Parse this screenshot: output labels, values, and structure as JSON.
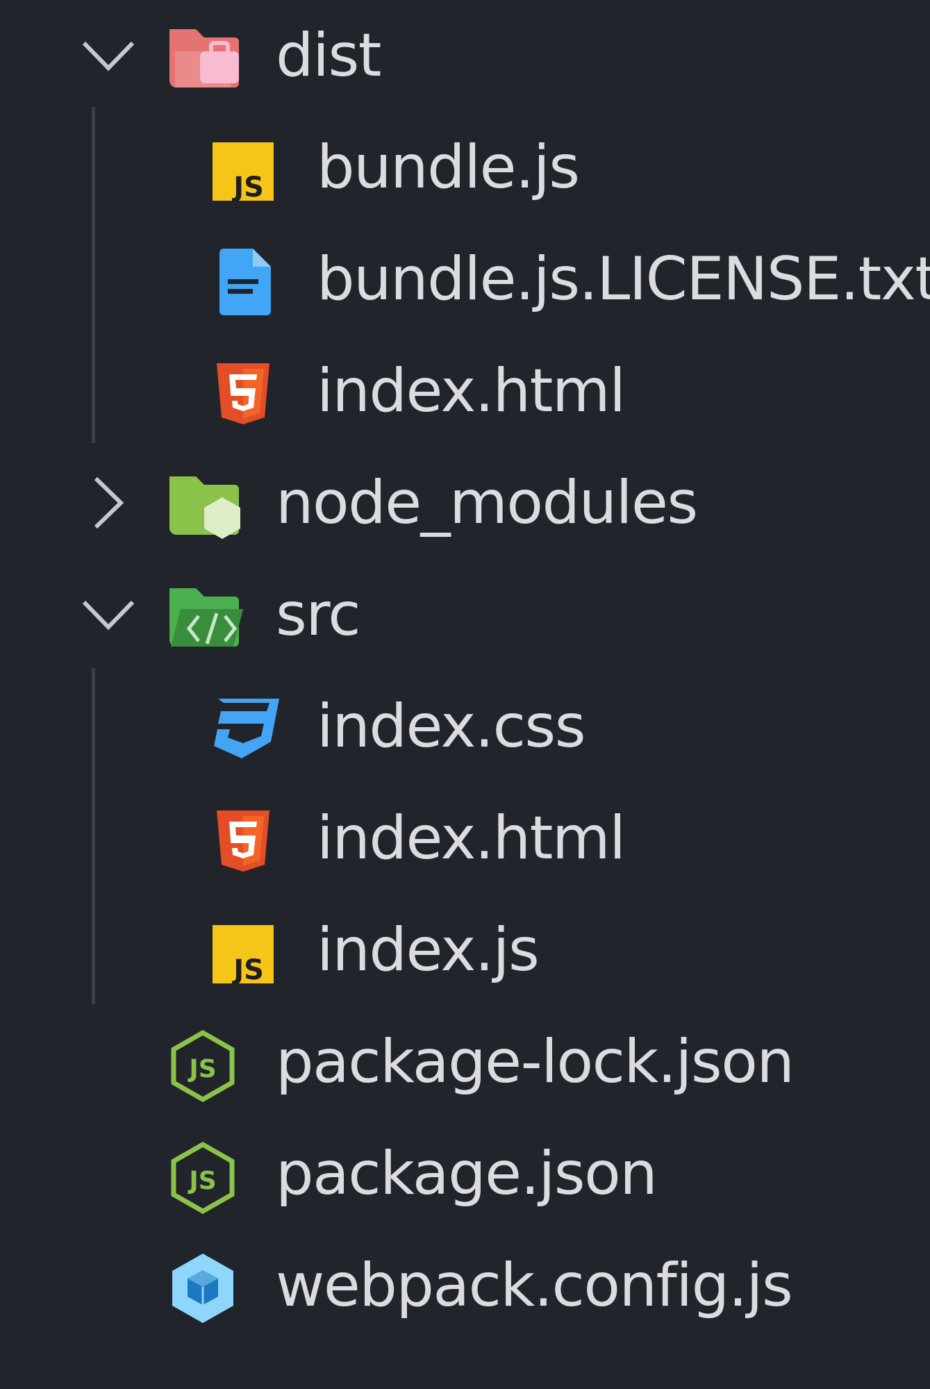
{
  "explorer": {
    "items": [
      {
        "label": "dist",
        "kind": "folder",
        "depth": 0,
        "expanded": true,
        "icon": "folder-dist-open-icon"
      },
      {
        "label": "bundle.js",
        "kind": "file",
        "depth": 1,
        "icon": "javascript-file-icon"
      },
      {
        "label": "bundle.js.LICENSE.txt",
        "kind": "file",
        "depth": 1,
        "icon": "text-document-icon"
      },
      {
        "label": "index.html",
        "kind": "file",
        "depth": 1,
        "icon": "html5-icon"
      },
      {
        "label": "node_modules",
        "kind": "folder",
        "depth": 0,
        "expanded": false,
        "icon": "folder-node-modules-icon"
      },
      {
        "label": "src",
        "kind": "folder",
        "depth": 0,
        "expanded": true,
        "icon": "folder-src-open-icon"
      },
      {
        "label": "index.css",
        "kind": "file",
        "depth": 1,
        "icon": "css3-icon"
      },
      {
        "label": "index.html",
        "kind": "file",
        "depth": 1,
        "icon": "html5-icon"
      },
      {
        "label": "index.js",
        "kind": "file",
        "depth": 1,
        "icon": "javascript-file-icon"
      },
      {
        "label": "package-lock.json",
        "kind": "file",
        "depth": 0,
        "icon": "nodejs-icon"
      },
      {
        "label": "package.json",
        "kind": "file",
        "depth": 0,
        "icon": "nodejs-icon"
      },
      {
        "label": "webpack.config.js",
        "kind": "file",
        "depth": 0,
        "icon": "webpack-icon"
      }
    ]
  },
  "colors": {
    "background": "#21252b",
    "text": "#dadce0",
    "indent_guide": "#3b3f46",
    "js_yellow": "#f5c518",
    "html_orange": "#e44d26",
    "css_blue": "#42a5f5",
    "node_green": "#8bc34a",
    "webpack_blue": "#8ed6fb"
  }
}
